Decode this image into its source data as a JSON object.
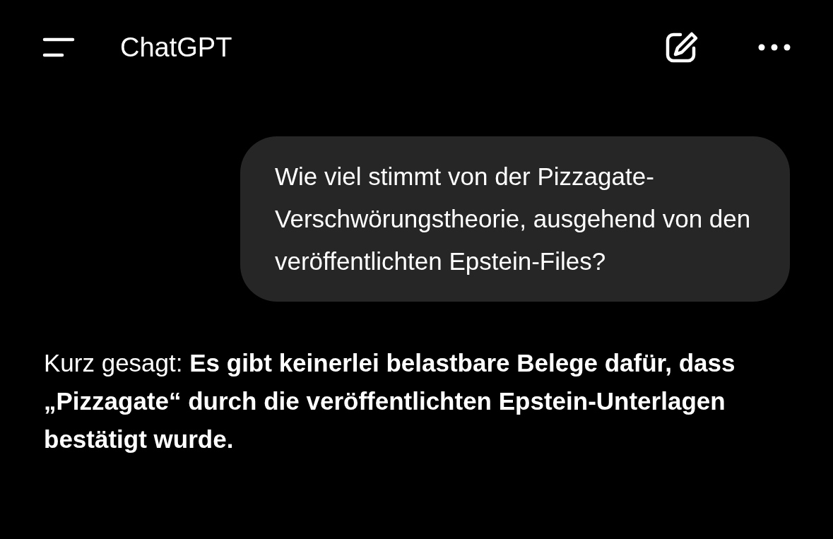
{
  "header": {
    "title": "ChatGPT"
  },
  "messages": [
    {
      "kind": "user",
      "text": "Wie viel stimmt von der Pizzagate-Verschwörungstheorie, ausgehend von den veröffentlichten Epstein-Files?"
    },
    {
      "kind": "assistant",
      "text": "Kurz gesagt: **Es gibt keinerlei belastbare Belege dafür, dass „Pizzagate“ durch die veröffentlichten Epstein-Unterlagen bestätigt wurde.**"
    }
  ]
}
